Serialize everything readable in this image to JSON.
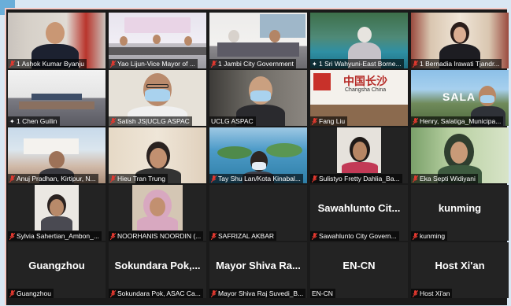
{
  "colors": {
    "mic_muted": "#e2382f",
    "speaking_outline": "#ddd95a",
    "frame_border": "#f7c9c3",
    "page_bg": "#d9e7f3"
  },
  "icons": {
    "muted": "mic-muted-icon",
    "pinned": "pin-icon"
  },
  "video_overlays": {
    "changsha_sign_cn": "中国长沙",
    "changsha_sign_en": "Changsha China",
    "salatiga_sign": "SALA"
  },
  "participants": [
    {
      "name": "1 Ashok Kumar Byanju",
      "muted": true,
      "pinned": false
    },
    {
      "name": "Yao Lijun-Vice Mayor of ...",
      "muted": true,
      "pinned": false
    },
    {
      "name": "1 Jambi City Government",
      "muted": true,
      "pinned": false
    },
    {
      "name": "1 Sri Wahyuni-East Borne...",
      "muted": false,
      "pinned": true
    },
    {
      "name": "1 Bernadia Irawati Tjandr...",
      "muted": true,
      "pinned": false
    },
    {
      "name": "1 Chen Guilin",
      "muted": false,
      "pinned": true
    },
    {
      "name": "Satish JS|UCLG ASPAC",
      "muted": true,
      "pinned": false
    },
    {
      "name": "UCLG ASPAC",
      "muted": false,
      "pinned": false
    },
    {
      "name": "Fang Liu",
      "muted": true,
      "pinned": false
    },
    {
      "name": "Henry, Salatiga_Municipa...",
      "muted": true,
      "pinned": false
    },
    {
      "name": "Anuj Pradhan, Kirtipur, N...",
      "muted": true,
      "pinned": false
    },
    {
      "name": "Hieu Tran Trung",
      "muted": true,
      "pinned": false
    },
    {
      "name": "Tay Shu Lan/Kota Kinabal...",
      "muted": true,
      "pinned": false
    },
    {
      "name": "Sulistyo Fretty Dahlia_Ba...",
      "muted": true,
      "pinned": false
    },
    {
      "name": "Eka Septi Widiyani",
      "muted": true,
      "pinned": false
    },
    {
      "name": "Sylvia Sahertian_Ambon_...",
      "muted": true,
      "pinned": false
    },
    {
      "name": "NOORHANIS NOORDIN (...",
      "muted": true,
      "pinned": false
    },
    {
      "name": "SAFRIZAL AKBAR",
      "muted": true,
      "pinned": false,
      "big": ""
    },
    {
      "name": "Sawahlunto City Govern...",
      "muted": true,
      "pinned": false,
      "big": "Sawahlunto Cit..."
    },
    {
      "name": "kunming",
      "muted": true,
      "pinned": false,
      "big": "kunming"
    },
    {
      "name": "Guangzhou",
      "muted": true,
      "pinned": false,
      "big": "Guangzhou"
    },
    {
      "name": "Sokundara Pok, ASAC Ca...",
      "muted": true,
      "pinned": false,
      "big": "Sokundara Pok,..."
    },
    {
      "name": "Mayor Shiva Raj Suvedi_B...",
      "muted": true,
      "pinned": false,
      "big": "Mayor Shiva Ra..."
    },
    {
      "name": "EN-CN",
      "muted": false,
      "pinned": false,
      "big": "EN-CN"
    },
    {
      "name": "Host Xi'an",
      "muted": true,
      "pinned": false,
      "big": "Host Xi'an"
    }
  ]
}
